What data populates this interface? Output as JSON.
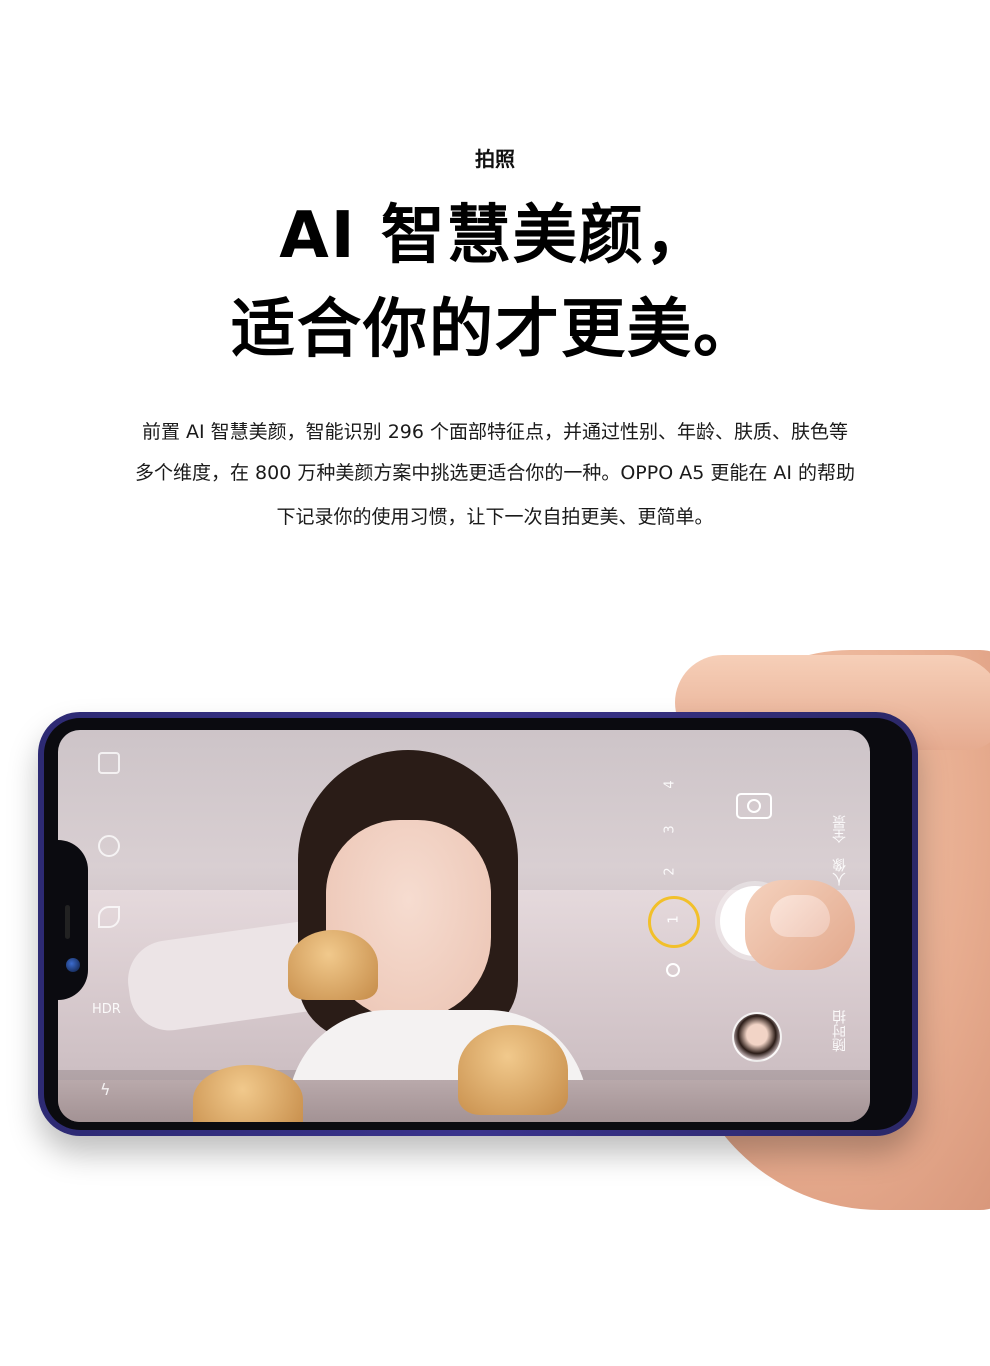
{
  "header": {
    "section_label": "拍照",
    "headline_line1": "AI 智慧美颜，",
    "headline_line2": "适合你的才更美。"
  },
  "description": {
    "line1": "前置 AI 智慧美颜，智能识别 296 个面部特征点，并通过性别、年龄、肤质、肤色等",
    "line2": "多个维度，在 800 万种美颜方案中挑选更适合你的一种。OPPO A5 更能在 AI 的帮助",
    "line3": "下记录你的使用习惯，让下一次自拍更美、更简单。"
  },
  "camera_ui": {
    "hdr_label": "HDR",
    "zoom_levels": [
      "4",
      "3",
      "2",
      "1"
    ],
    "active_zoom": "1",
    "mode_portrait": "人像",
    "mode_panorama": "全景",
    "mode_other": "随时拍",
    "icons": [
      "gallery-icon",
      "timer-icon",
      "beauty-icon",
      "flash-icon",
      "camera-switch-icon"
    ]
  }
}
